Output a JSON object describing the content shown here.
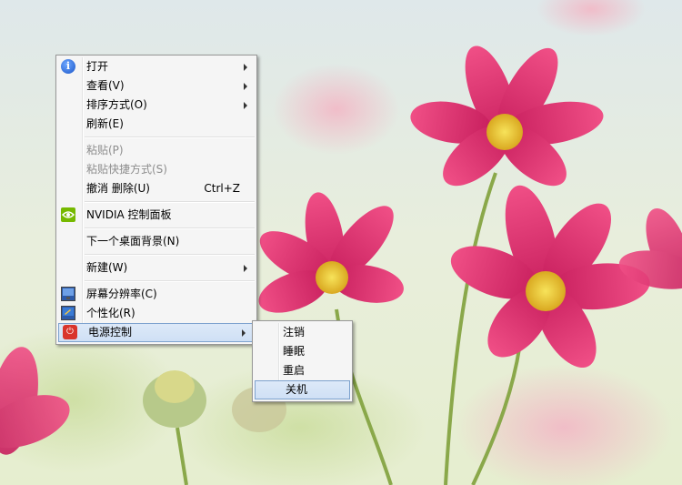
{
  "context_menu": {
    "items": [
      {
        "label": "打开"
      },
      {
        "label": "查看(V)"
      },
      {
        "label": "排序方式(O)"
      },
      {
        "label": "刷新(E)"
      },
      {
        "label": "粘贴(P)"
      },
      {
        "label": "粘贴快捷方式(S)"
      },
      {
        "label": "撤消 删除(U)",
        "shortcut": "Ctrl+Z"
      },
      {
        "label": "NVIDIA 控制面板"
      },
      {
        "label": "下一个桌面背景(N)"
      },
      {
        "label": "新建(W)"
      },
      {
        "label": "屏幕分辨率(C)"
      },
      {
        "label": "个性化(R)"
      },
      {
        "label": "电源控制"
      }
    ]
  },
  "power_submenu": {
    "items": [
      {
        "label": "注销"
      },
      {
        "label": "睡眠"
      },
      {
        "label": "重启"
      },
      {
        "label": "关机"
      }
    ]
  },
  "icons": {
    "open": "info-icon",
    "nvidia": "nvidia-icon",
    "resolution": "monitor-icon",
    "personalize": "personalize-icon",
    "power": "power-icon"
  },
  "colors": {
    "menu_bg": "#f5f5f5",
    "highlight_border": "#7da2ce",
    "highlight_bg": "#dde9f8",
    "flower_pink": "#e0306f"
  }
}
